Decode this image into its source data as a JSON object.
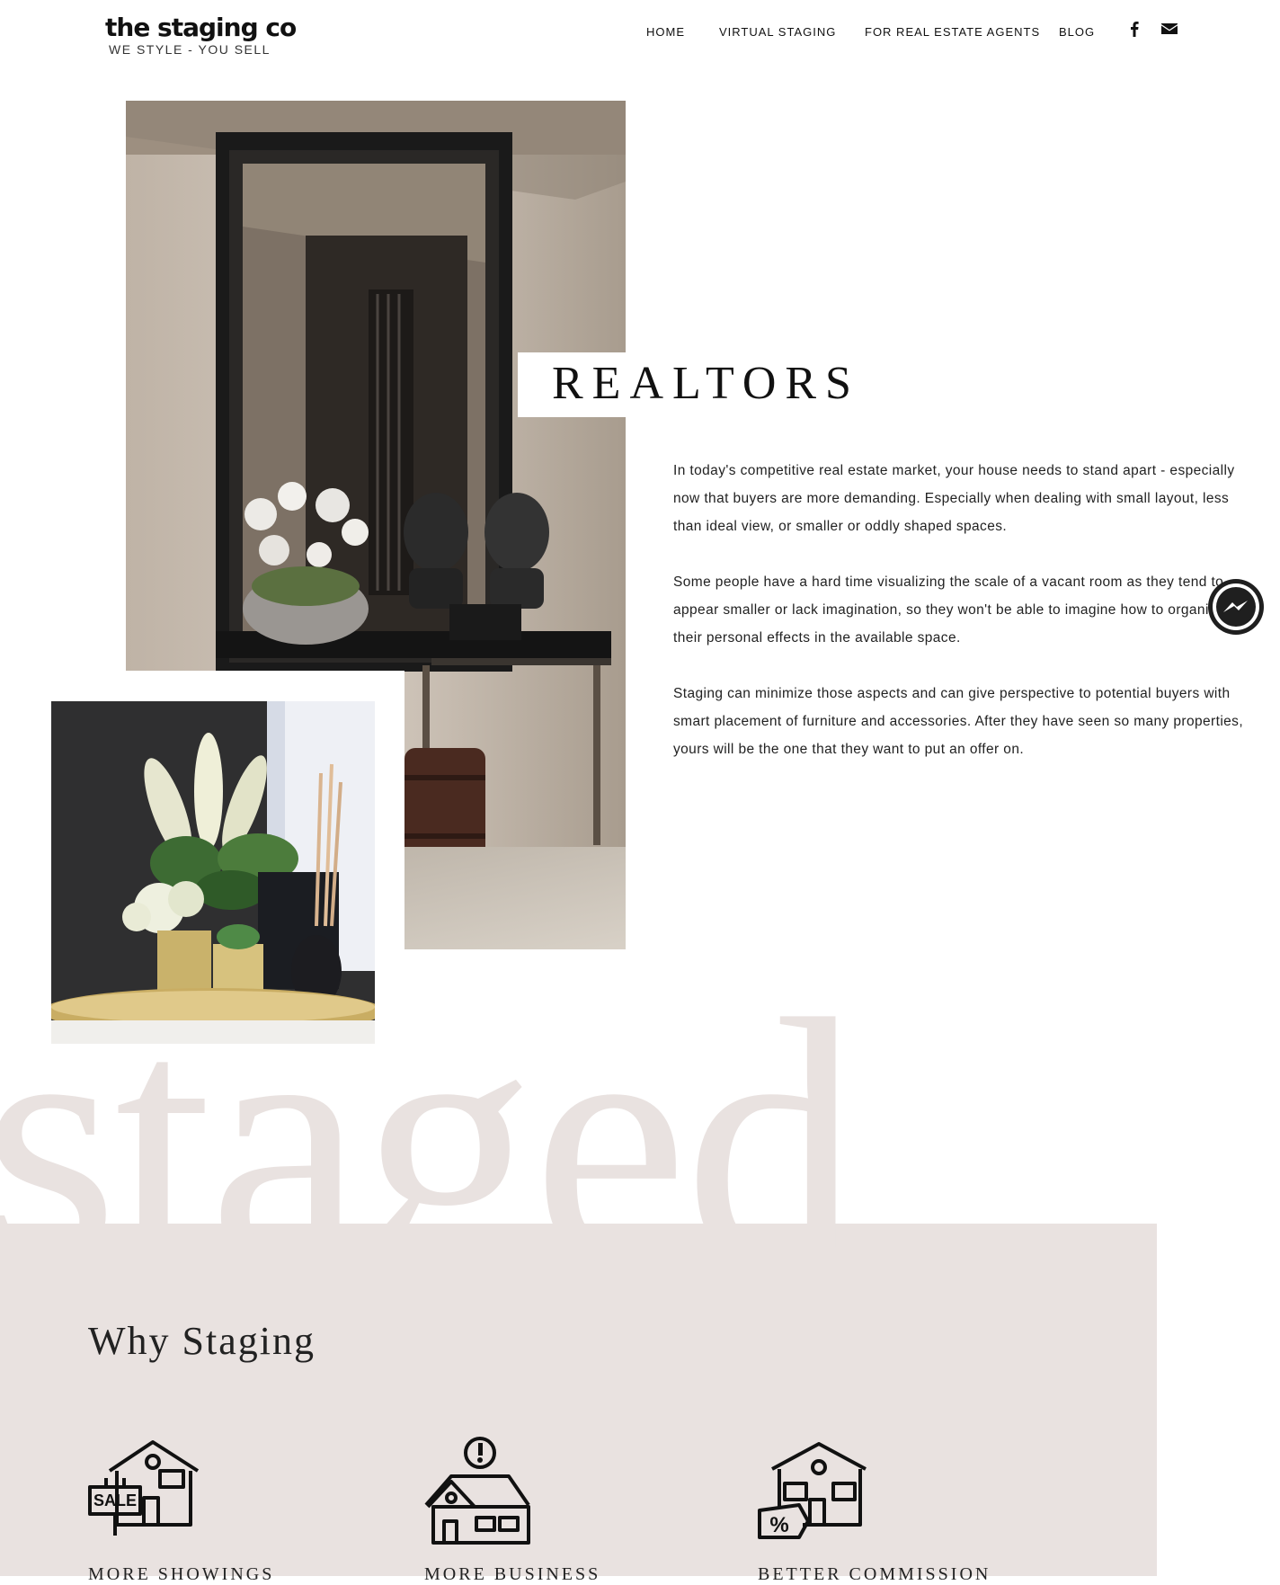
{
  "header": {
    "logo_main": "the staging co",
    "logo_sub": "WE STYLE - YOU SELL",
    "nav": [
      "HOME",
      "VIRTUAL STAGING",
      "FOR REAL ESTATE AGENTS",
      "BLOG"
    ],
    "social_icons": [
      "facebook-icon",
      "envelope-icon"
    ]
  },
  "hero": {
    "title": "REALTORS",
    "paragraphs": [
      "In today's competitive real estate market, your house needs to stand apart - especially now that buyers are more demanding. Especially when dealing with small layout, less than ideal view, or smaller or oddly shaped spaces.",
      "Some people have a hard time visualizing the scale of a vacant room as they tend to appear smaller or lack imagination, so they won't be able to imagine how to organise their personal effects in the available space.",
      "Staging can minimize those aspects and can give perspective to potential buyers with smart placement of furniture and accessories. After they have seen so many properties, yours will be the one that they want to put an offer on."
    ]
  },
  "staged_word": "staged",
  "why": {
    "heading": "Why Staging",
    "features": [
      {
        "icon": "house-sale-sign-icon",
        "label": "MORE SHOWINGS"
      },
      {
        "icon": "house-alert-icon",
        "label": "MORE BUSINESS"
      },
      {
        "icon": "house-percent-icon",
        "label": "BETTER COMMISSION"
      }
    ]
  },
  "colors": {
    "band": "#e9e2e0",
    "text": "#1f1f1f"
  }
}
